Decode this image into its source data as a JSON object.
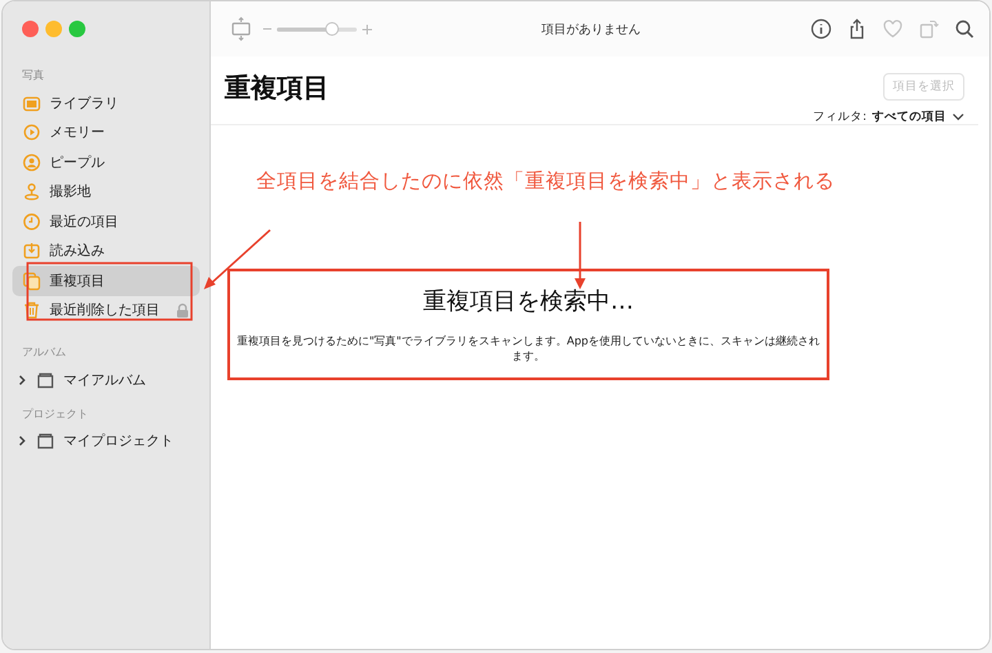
{
  "toolbar": {
    "zoom_slider": {
      "level": 0.72
    },
    "status": "項目がありません",
    "icons": [
      {
        "disabled": false
      },
      {
        "disabled": false
      },
      {
        "disabled": true
      },
      {
        "disabled": true
      },
      {
        "disabled": false
      }
    ]
  },
  "sidebar": {
    "sections": [
      {
        "title": "写真",
        "items": [
          {
            "label": "ライブラリ",
            "selected": false,
            "locked": false
          },
          {
            "label": "メモリー",
            "selected": false,
            "locked": false
          },
          {
            "label": "ピープル",
            "selected": false,
            "locked": false
          },
          {
            "label": "撮影地",
            "selected": false,
            "locked": false
          },
          {
            "label": "最近の項目",
            "selected": false,
            "locked": false
          },
          {
            "label": "読み込み",
            "selected": false,
            "locked": false
          },
          {
            "label": "重複項目",
            "selected": true,
            "locked": false
          },
          {
            "label": "最近削除した項目",
            "selected": false,
            "locked": true
          }
        ]
      },
      {
        "title": "アルバム",
        "items": [
          {
            "label": "マイアルバム",
            "selected": false,
            "locked": false,
            "expanded": false
          }
        ]
      },
      {
        "title": "プロジェクト",
        "items": [
          {
            "label": "マイプロジェクト",
            "selected": false,
            "locked": false,
            "expanded": false
          }
        ]
      }
    ]
  },
  "main": {
    "title": "重複項目",
    "select_button": {
      "label": "項目を選択",
      "disabled": true
    },
    "filter": {
      "label": "フィルタ:",
      "value": "すべての項目"
    },
    "empty_state": {
      "heading": "重複項目を検索中…",
      "message": "重複項目を見つけるために\"写真\"でライブラリをスキャンします。Appを使用していないときに、スキャンは継続されます。"
    }
  },
  "annotation": {
    "text": "全項目を結合したのに依然「重複項目を検索中」と表示される"
  }
}
